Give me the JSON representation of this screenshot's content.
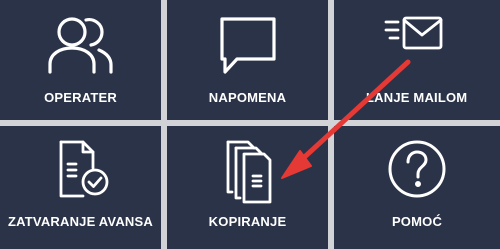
{
  "tiles": [
    {
      "id": "operater",
      "label": "OPERATER",
      "icon": "users-icon"
    },
    {
      "id": "napomena",
      "label": "NAPOMENA",
      "icon": "speech-bubble-icon"
    },
    {
      "id": "slanje-mailom",
      "label": "SLANJE MAILOM",
      "label_visible": "LANJE MAILOM",
      "icon": "envelope-send-icon"
    },
    {
      "id": "zatvaranje-avansa",
      "label": "ZATVARANJE AVANSA",
      "icon": "document-check-icon"
    },
    {
      "id": "kopiranje",
      "label": "KOPIRANJE",
      "icon": "copy-documents-icon"
    },
    {
      "id": "pomoc",
      "label": "POMOĆ",
      "icon": "question-circle-icon"
    }
  ],
  "colors": {
    "tile_background": "#2b3348",
    "page_background": "#d2d3d6",
    "icon": "#ffffff",
    "annotation_arrow": "#e53935"
  },
  "annotation": {
    "icon": "red-arrow-icon"
  }
}
